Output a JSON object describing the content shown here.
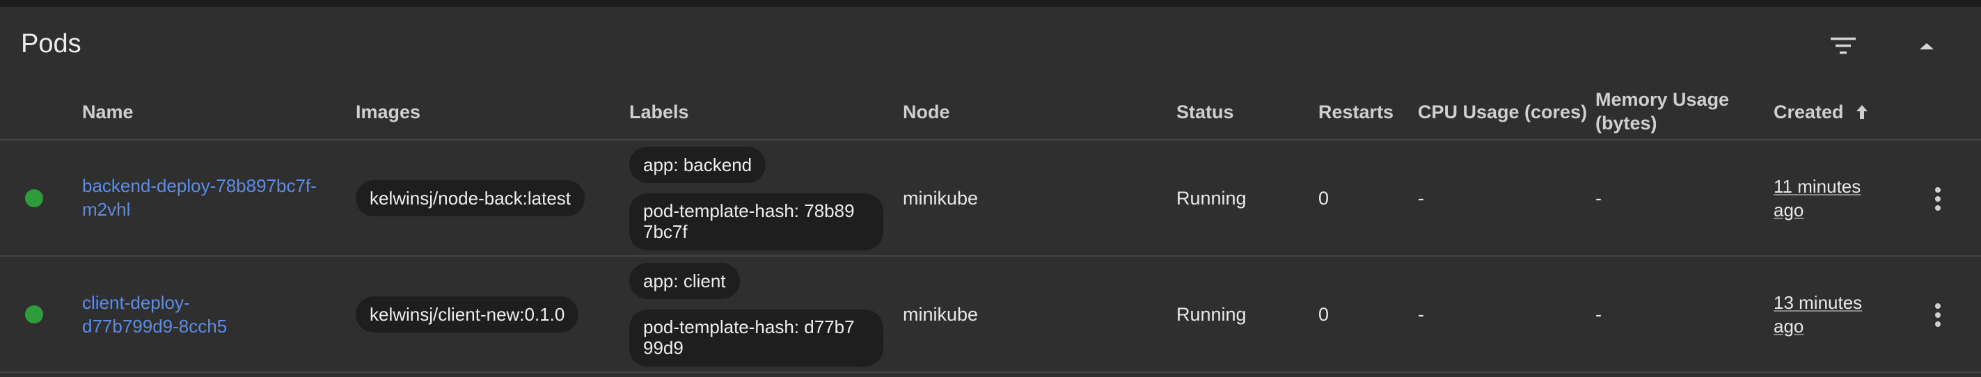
{
  "panel": {
    "title": "Pods"
  },
  "columns": {
    "name": "Name",
    "images": "Images",
    "labels": "Labels",
    "node": "Node",
    "status": "Status",
    "restarts": "Restarts",
    "cpu": "CPU Usage (cores)",
    "memory_line1": "Memory Usage",
    "memory_line2": "(bytes)",
    "created": "Created",
    "sort_icon": "arrow-up-icon"
  },
  "colors": {
    "running": "#2e9c3a",
    "link": "#5b8de8"
  },
  "rows": [
    {
      "status_icon": "status-running-icon",
      "name_line1": "backend-deploy-78b897bc7f-",
      "name_line2": "m2vhl",
      "image": "kelwinsj/node-back:latest",
      "label_app": "app: backend",
      "label_hash_line1": "pod-template-hash: 78b89",
      "label_hash_line2": "7bc7f",
      "node": "minikube",
      "status": "Running",
      "restarts": "0",
      "cpu": "-",
      "memory": "-",
      "created_line1": "11 minutes",
      "created_line2": "ago"
    },
    {
      "status_icon": "status-running-icon",
      "name_line1": "client-deploy-",
      "name_line2": "d77b799d9-8cch5",
      "image": "kelwinsj/client-new:0.1.0",
      "label_app": "app: client",
      "label_hash_line1": "pod-template-hash: d77b7",
      "label_hash_line2": "99d9",
      "node": "minikube",
      "status": "Running",
      "restarts": "0",
      "cpu": "-",
      "memory": "-",
      "created_line1": "13 minutes",
      "created_line2": "ago"
    }
  ]
}
